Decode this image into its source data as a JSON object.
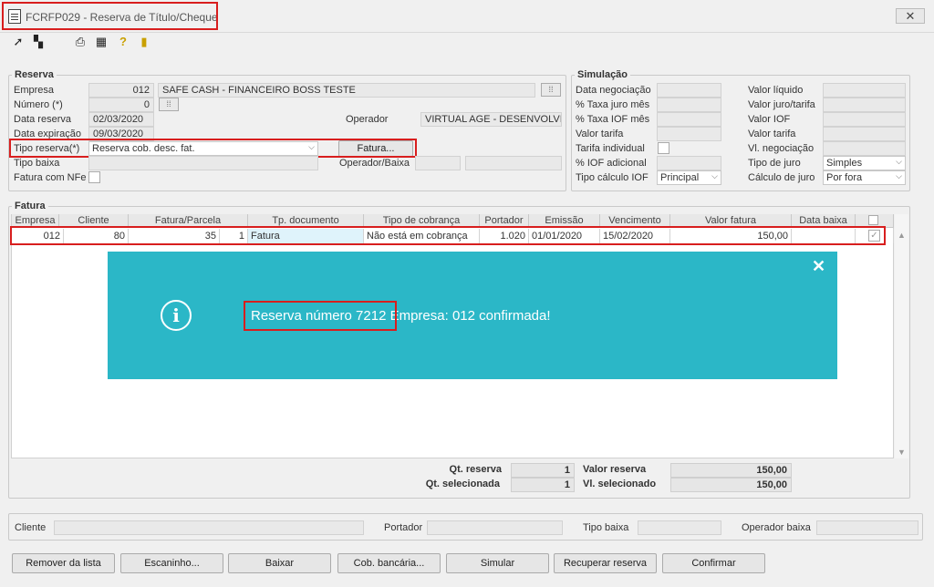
{
  "window": {
    "title": "FCRFP029 - Reserva de Título/Cheque",
    "close": "✕"
  },
  "toolbar": {
    "icons": [
      "arrow-in-icon",
      "layers-icon",
      "printer-icon",
      "calculator-icon",
      "help-icon",
      "exit-door-icon"
    ]
  },
  "reserva": {
    "legend": "Reserva",
    "empresa_label": "Empresa",
    "empresa_value": "012",
    "empresa_name": "SAFE CASH - FINANCEIRO BOSS TESTE",
    "numero_label": "Número (*)",
    "numero_value": "0",
    "data_reserva_label": "Data reserva",
    "data_reserva_value": "02/03/2020",
    "data_exp_label": "Data expiração",
    "data_exp_value": "09/03/2020",
    "operador_label": "Operador",
    "operador_value": "VIRTUAL AGE - DESENVOLVIM",
    "tipo_reserva_label": "Tipo reserva(*)",
    "tipo_reserva_value": "Reserva cob. desc. fat.",
    "fatura_button": "Fatura...",
    "tipo_baixa_label": "Tipo baixa",
    "operador_baixa_label": "Operador/Baixa",
    "fatura_nfe_label": "Fatura com NFe"
  },
  "simulacao": {
    "legend": "Simulação",
    "left": [
      {
        "label": "Data negociação"
      },
      {
        "label": "% Taxa juro mês"
      },
      {
        "label": "% Taxa IOF mês"
      },
      {
        "label": "Valor tarifa"
      },
      {
        "label": "Tarifa individual"
      },
      {
        "label": "% IOF adicional"
      },
      {
        "label": "Tipo  cálculo IOF",
        "value": "Principal"
      }
    ],
    "right": [
      {
        "label": "Valor líquido"
      },
      {
        "label": "Valor juro/tarifa"
      },
      {
        "label": "Valor IOF"
      },
      {
        "label": "Valor tarifa"
      },
      {
        "label": "Vl. negociação"
      },
      {
        "label": "Tipo de juro",
        "value": "Simples"
      },
      {
        "label": "Cálculo de juro",
        "value": "Por fora"
      }
    ]
  },
  "fatura": {
    "legend": "Fatura",
    "columns": [
      "Empresa",
      "Cliente",
      "Fatura/Parcela",
      "Tp. documento",
      "Tipo de cobrança",
      "Portador",
      "Emissão",
      "Vencimento",
      "Valor fatura",
      "Data baixa"
    ],
    "row": [
      "012",
      "80",
      "35",
      "1",
      "Fatura",
      "Não está em cobrança",
      "1.020",
      "01/01/2020",
      "15/02/2020",
      "150,00",
      ""
    ],
    "totals": {
      "qt_reserva_label": "Qt. reserva",
      "qt_reserva_value": "1",
      "qt_sel_label": "Qt. selecionada",
      "qt_sel_value": "1",
      "valor_reserva_label": "Valor reserva",
      "valor_reserva_value": "150,00",
      "vl_sel_label": "Vl. selecionado",
      "vl_sel_value": "150,00"
    }
  },
  "toast": {
    "icon": "info-icon",
    "highlight": "Reserva número 7212",
    "rest": " Empresa: 012 confirmada!",
    "close": "✕"
  },
  "footer": {
    "cliente_label": "Cliente",
    "portador_label": "Portador",
    "tipo_baixa_label": "Tipo baixa",
    "operador_baixa_label": "Operador baixa"
  },
  "buttons": [
    "Remover da lista",
    "Escaninho...",
    "Baixar",
    "Cob. bancária...",
    "Simular",
    "Recuperar reserva",
    "Confirmar"
  ]
}
